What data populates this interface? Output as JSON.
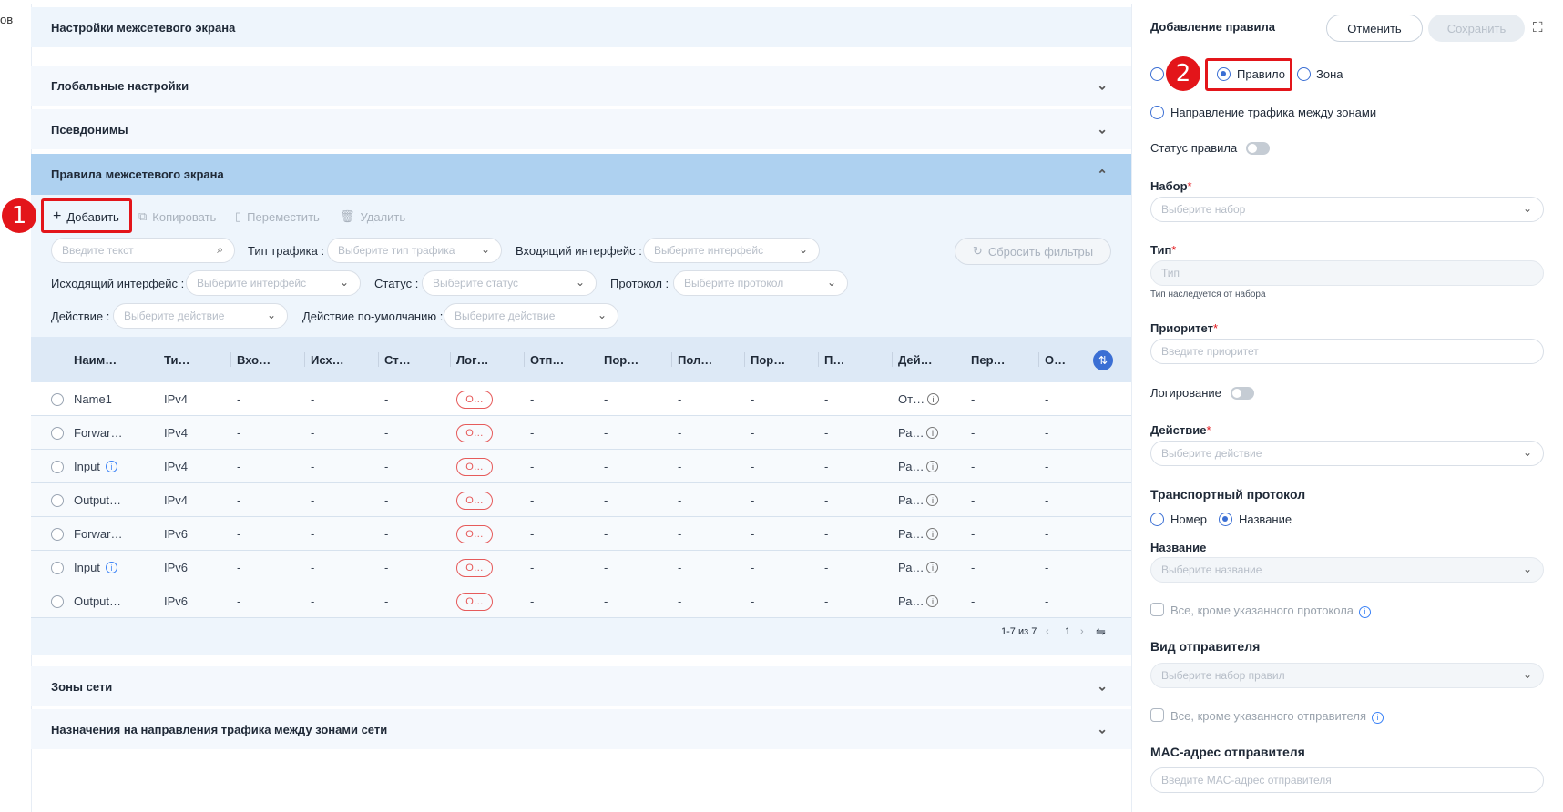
{
  "clipped_text": "ов",
  "sections": {
    "firewall_settings": "Настройки межсетевого экрана",
    "global_settings": "Глобальные настройки",
    "aliases": "Псевдонимы",
    "firewall_rules": "Правила межсетевого экрана",
    "network_zones": "Зоны сети",
    "zone_traffic": "Назначения на направления трафика между зонами сети"
  },
  "toolbar": {
    "add": "Добавить",
    "copy": "Копировать",
    "move": "Переместить",
    "delete": "Удалить"
  },
  "badges": {
    "one": "1",
    "two": "2"
  },
  "filters": {
    "search_placeholder": "Введите текст",
    "traffic_type_label": "Тип трафика :",
    "traffic_type_placeholder": "Выберите тип трафика",
    "in_iface_label": "Входящий интерфейс :",
    "in_iface_placeholder": "Выберите интерфейс",
    "reset": "Сбросить фильтры",
    "out_iface_label": "Исходящий интерфейс :",
    "out_iface_placeholder": "Выберите интерфейс",
    "status_label": "Статус :",
    "status_placeholder": "Выберите статус",
    "protocol_label": "Протокол :",
    "protocol_placeholder": "Выберите протокол",
    "action_label": "Действие :",
    "action_placeholder": "Выберите действие",
    "default_action_label": "Действие по-умолчанию :",
    "default_action_placeholder": "Выберите действие"
  },
  "table": {
    "columns": [
      "Наим…",
      "Ти…",
      "Вхо…",
      "Исх…",
      "Ст…",
      "Лог…",
      "Отп…",
      "Пор…",
      "Пол…",
      "Пор…",
      "П…",
      "Дей…",
      "Пер…",
      "О…"
    ],
    "rows": [
      {
        "name": "Name1",
        "type": "IPv4",
        "log": "О…",
        "action": "От…",
        "info": false
      },
      {
        "name": "Forwar…",
        "type": "IPv4",
        "log": "О…",
        "action": "Ра…",
        "info": false
      },
      {
        "name": "Input",
        "type": "IPv4",
        "log": "О…",
        "action": "Ра…",
        "info": true
      },
      {
        "name": "Output…",
        "type": "IPv4",
        "log": "О…",
        "action": "Ра…",
        "info": false
      },
      {
        "name": "Forwar…",
        "type": "IPv6",
        "log": "О…",
        "action": "Ра…",
        "info": false
      },
      {
        "name": "Input",
        "type": "IPv6",
        "log": "О…",
        "action": "Ра…",
        "info": true
      },
      {
        "name": "Output…",
        "type": "IPv6",
        "log": "О…",
        "action": "Ра…",
        "info": false
      }
    ],
    "dash": "-"
  },
  "pagination": {
    "range": "1-7 из 7",
    "page": "1"
  },
  "panel": {
    "title": "Добавление правила",
    "cancel": "Отменить",
    "save": "Сохранить",
    "radio_rule": "Правило",
    "radio_zone": "Зона",
    "radio_direction": "Направление трафика между зонами",
    "status_label": "Статус правила",
    "set_label": "Набор",
    "set_placeholder": "Выберите набор",
    "type_label": "Тип",
    "type_placeholder": "Тип",
    "type_hint": "Тип наследуется от набора",
    "priority_label": "Приоритет",
    "priority_placeholder": "Введите приоритет",
    "logging_label": "Логирование",
    "action_label": "Действие",
    "action_placeholder": "Выберите действие",
    "transport_label": "Транспортный протокол",
    "radio_number": "Номер",
    "radio_name": "Название",
    "name_label": "Название",
    "name_placeholder": "Выберите название",
    "except_protocol": "Все, кроме указанного протокола",
    "sender_type_label": "Вид отправителя",
    "sender_type_placeholder": "Выберите набор правил",
    "except_sender": "Все, кроме указанного отправителя",
    "mac_label": "MAC-адрес отправителя",
    "mac_placeholder": "Введите MAC-адрес отправителя",
    "required_mark": "*"
  }
}
